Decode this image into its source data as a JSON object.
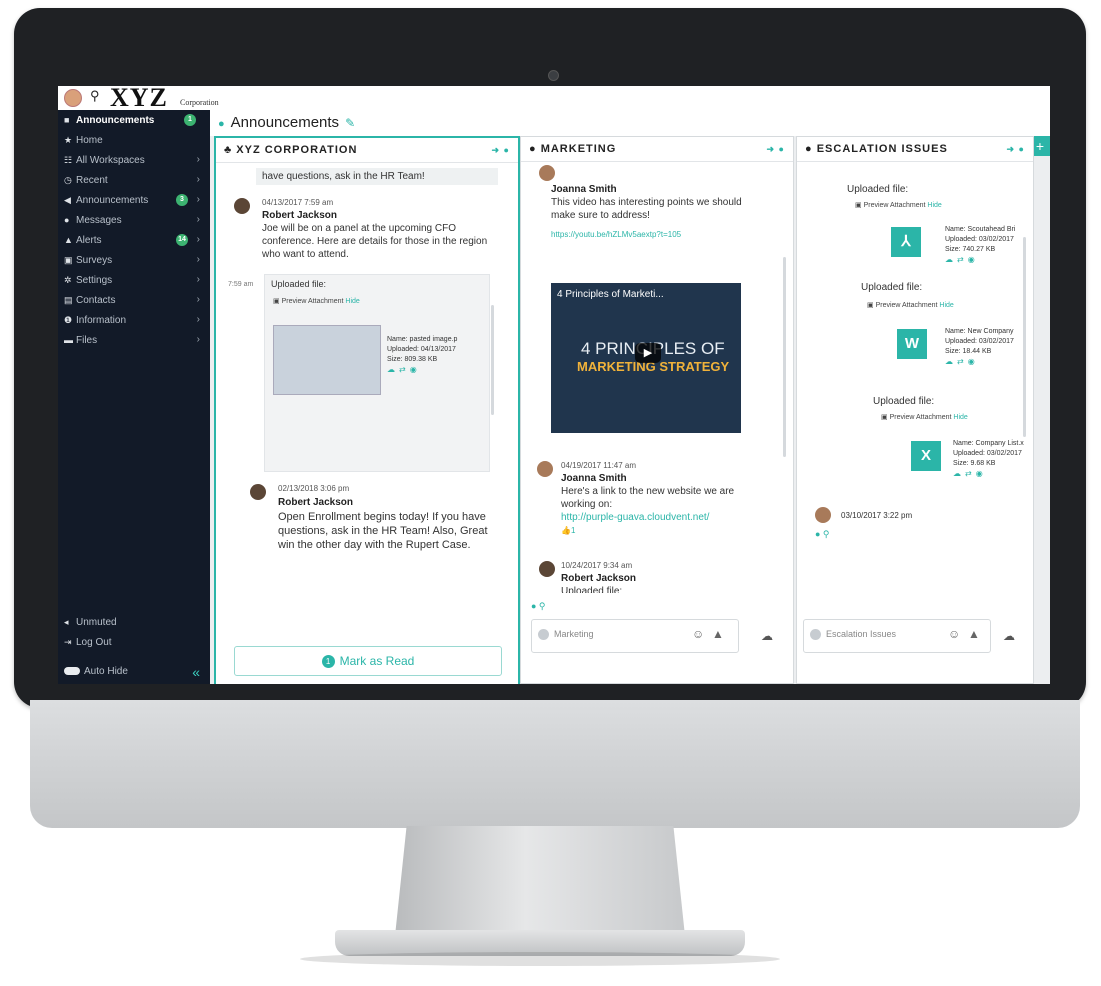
{
  "app": {
    "logo": "XYZ",
    "logo_sub": "Corporation",
    "workspace_title": "Announcements"
  },
  "colors": {
    "accent": "#2bb5a8",
    "sidebar": "#121a28",
    "badge": "#3cb371"
  },
  "sidebar": {
    "items": [
      {
        "label": "Announcements",
        "icon": "megaphone-icon"
      },
      {
        "label": "Home",
        "icon": "star-icon"
      },
      {
        "label": "All Workspaces",
        "icon": "grid-icon"
      },
      {
        "label": "Recent",
        "icon": "clock-icon"
      },
      {
        "label": "Announcements",
        "icon": "megaphone-icon"
      },
      {
        "label": "Messages",
        "icon": "chat-icon"
      },
      {
        "label": "Alerts",
        "icon": "warning-icon"
      },
      {
        "label": "Surveys",
        "icon": "survey-icon"
      },
      {
        "label": "Settings",
        "icon": "gear-icon"
      },
      {
        "label": "Contacts",
        "icon": "contacts-icon"
      },
      {
        "label": "Information",
        "icon": "info-icon"
      },
      {
        "label": "Files",
        "icon": "folder-icon"
      }
    ],
    "badges": {
      "top": "1",
      "announcements": "3",
      "alerts": "14"
    },
    "unmuted": "Unmuted",
    "logout": "Log Out",
    "autohide": "Auto Hide"
  },
  "col1": {
    "title": "XYZ CORPORATION",
    "top_snippet": "have questions, ask in the HR Team!",
    "msg1": {
      "date": "04/13/2017 7:59 am",
      "name": "Robert Jackson",
      "body": "Joe will be on a panel at the upcoming CFO conference. Here are details for those in the region who want to attend."
    },
    "attach_time": "7:59 am",
    "uploaded": "Uploaded file:",
    "preview": "Preview Attachment",
    "hide": "Hide",
    "file": {
      "name": "Name: pasted image.p",
      "uploaded": "Uploaded: 04/13/2017",
      "size": "Size: 809.38 KB"
    },
    "msg2": {
      "date": "02/13/2018 3:06 pm",
      "name": "Robert Jackson",
      "body": "Open Enrollment begins today! If you have questions, ask in the HR Team! Also, Great win the other day with the Rupert Case."
    },
    "mark_count": "1",
    "mark_label": "Mark as Read"
  },
  "col2": {
    "title": "MARKETING",
    "msg1": {
      "name": "Joanna Smith",
      "body": "This video has interesting points we should make sure to address!",
      "link": "https://youtu.be/hZLMv5aextp?t=105"
    },
    "video": {
      "title": "4 Principles of Marketi...",
      "line1": "4 PRINCIPLES OF",
      "line2": "MARKETING STRATEGY"
    },
    "msg2": {
      "date": "04/19/2017 11:47 am",
      "name": "Joanna Smith",
      "body": "Here's a link to the new website we are working on:",
      "link": "http://purple-guava.cloudvent.net/",
      "likes": "1"
    },
    "msg3": {
      "date": "10/24/2017 9:34 am",
      "name": "Robert Jackson",
      "body": "Uploaded file:"
    },
    "placeholder": "Marketing"
  },
  "col3": {
    "title": "ESCALATION ISSUES",
    "uploaded": "Uploaded file:",
    "preview": "Preview Attachment",
    "hide": "Hide",
    "files": [
      {
        "letter": "PDF",
        "name": "Name: Scoutahead Bri",
        "uploaded": "Uploaded: 03/02/2017",
        "size": "Size: 740.27 KB"
      },
      {
        "letter": "W",
        "name": "Name: New Company",
        "uploaded": "Uploaded: 03/02/2017",
        "size": "Size: 18.44 KB"
      },
      {
        "letter": "X",
        "name": "Name: Company List.x",
        "uploaded": "Uploaded: 03/02/2017",
        "size": "Size: 9.68 KB"
      }
    ],
    "last_date": "03/10/2017 3:22 pm",
    "placeholder": "Escalation Issues"
  }
}
